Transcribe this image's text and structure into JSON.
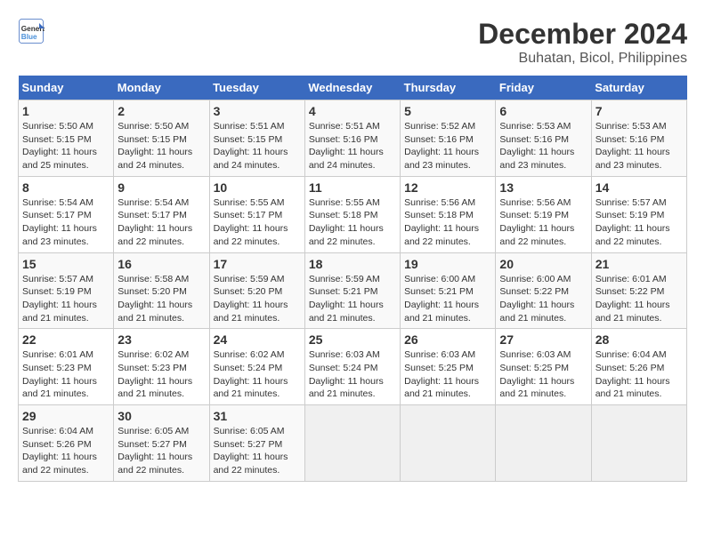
{
  "logo": {
    "line1": "General",
    "line2": "Blue"
  },
  "title": "December 2024",
  "subtitle": "Buhatan, Bicol, Philippines",
  "days_of_week": [
    "Sunday",
    "Monday",
    "Tuesday",
    "Wednesday",
    "Thursday",
    "Friday",
    "Saturday"
  ],
  "weeks": [
    [
      {
        "day": "1",
        "info": "Sunrise: 5:50 AM\nSunset: 5:15 PM\nDaylight: 11 hours\nand 25 minutes."
      },
      {
        "day": "2",
        "info": "Sunrise: 5:50 AM\nSunset: 5:15 PM\nDaylight: 11 hours\nand 24 minutes."
      },
      {
        "day": "3",
        "info": "Sunrise: 5:51 AM\nSunset: 5:15 PM\nDaylight: 11 hours\nand 24 minutes."
      },
      {
        "day": "4",
        "info": "Sunrise: 5:51 AM\nSunset: 5:16 PM\nDaylight: 11 hours\nand 24 minutes."
      },
      {
        "day": "5",
        "info": "Sunrise: 5:52 AM\nSunset: 5:16 PM\nDaylight: 11 hours\nand 23 minutes."
      },
      {
        "day": "6",
        "info": "Sunrise: 5:53 AM\nSunset: 5:16 PM\nDaylight: 11 hours\nand 23 minutes."
      },
      {
        "day": "7",
        "info": "Sunrise: 5:53 AM\nSunset: 5:16 PM\nDaylight: 11 hours\nand 23 minutes."
      }
    ],
    [
      {
        "day": "8",
        "info": "Sunrise: 5:54 AM\nSunset: 5:17 PM\nDaylight: 11 hours\nand 23 minutes."
      },
      {
        "day": "9",
        "info": "Sunrise: 5:54 AM\nSunset: 5:17 PM\nDaylight: 11 hours\nand 22 minutes."
      },
      {
        "day": "10",
        "info": "Sunrise: 5:55 AM\nSunset: 5:17 PM\nDaylight: 11 hours\nand 22 minutes."
      },
      {
        "day": "11",
        "info": "Sunrise: 5:55 AM\nSunset: 5:18 PM\nDaylight: 11 hours\nand 22 minutes."
      },
      {
        "day": "12",
        "info": "Sunrise: 5:56 AM\nSunset: 5:18 PM\nDaylight: 11 hours\nand 22 minutes."
      },
      {
        "day": "13",
        "info": "Sunrise: 5:56 AM\nSunset: 5:19 PM\nDaylight: 11 hours\nand 22 minutes."
      },
      {
        "day": "14",
        "info": "Sunrise: 5:57 AM\nSunset: 5:19 PM\nDaylight: 11 hours\nand 22 minutes."
      }
    ],
    [
      {
        "day": "15",
        "info": "Sunrise: 5:57 AM\nSunset: 5:19 PM\nDaylight: 11 hours\nand 21 minutes."
      },
      {
        "day": "16",
        "info": "Sunrise: 5:58 AM\nSunset: 5:20 PM\nDaylight: 11 hours\nand 21 minutes."
      },
      {
        "day": "17",
        "info": "Sunrise: 5:59 AM\nSunset: 5:20 PM\nDaylight: 11 hours\nand 21 minutes."
      },
      {
        "day": "18",
        "info": "Sunrise: 5:59 AM\nSunset: 5:21 PM\nDaylight: 11 hours\nand 21 minutes."
      },
      {
        "day": "19",
        "info": "Sunrise: 6:00 AM\nSunset: 5:21 PM\nDaylight: 11 hours\nand 21 minutes."
      },
      {
        "day": "20",
        "info": "Sunrise: 6:00 AM\nSunset: 5:22 PM\nDaylight: 11 hours\nand 21 minutes."
      },
      {
        "day": "21",
        "info": "Sunrise: 6:01 AM\nSunset: 5:22 PM\nDaylight: 11 hours\nand 21 minutes."
      }
    ],
    [
      {
        "day": "22",
        "info": "Sunrise: 6:01 AM\nSunset: 5:23 PM\nDaylight: 11 hours\nand 21 minutes."
      },
      {
        "day": "23",
        "info": "Sunrise: 6:02 AM\nSunset: 5:23 PM\nDaylight: 11 hours\nand 21 minutes."
      },
      {
        "day": "24",
        "info": "Sunrise: 6:02 AM\nSunset: 5:24 PM\nDaylight: 11 hours\nand 21 minutes."
      },
      {
        "day": "25",
        "info": "Sunrise: 6:03 AM\nSunset: 5:24 PM\nDaylight: 11 hours\nand 21 minutes."
      },
      {
        "day": "26",
        "info": "Sunrise: 6:03 AM\nSunset: 5:25 PM\nDaylight: 11 hours\nand 21 minutes."
      },
      {
        "day": "27",
        "info": "Sunrise: 6:03 AM\nSunset: 5:25 PM\nDaylight: 11 hours\nand 21 minutes."
      },
      {
        "day": "28",
        "info": "Sunrise: 6:04 AM\nSunset: 5:26 PM\nDaylight: 11 hours\nand 21 minutes."
      }
    ],
    [
      {
        "day": "29",
        "info": "Sunrise: 6:04 AM\nSunset: 5:26 PM\nDaylight: 11 hours\nand 22 minutes."
      },
      {
        "day": "30",
        "info": "Sunrise: 6:05 AM\nSunset: 5:27 PM\nDaylight: 11 hours\nand 22 minutes."
      },
      {
        "day": "31",
        "info": "Sunrise: 6:05 AM\nSunset: 5:27 PM\nDaylight: 11 hours\nand 22 minutes."
      },
      null,
      null,
      null,
      null
    ]
  ]
}
